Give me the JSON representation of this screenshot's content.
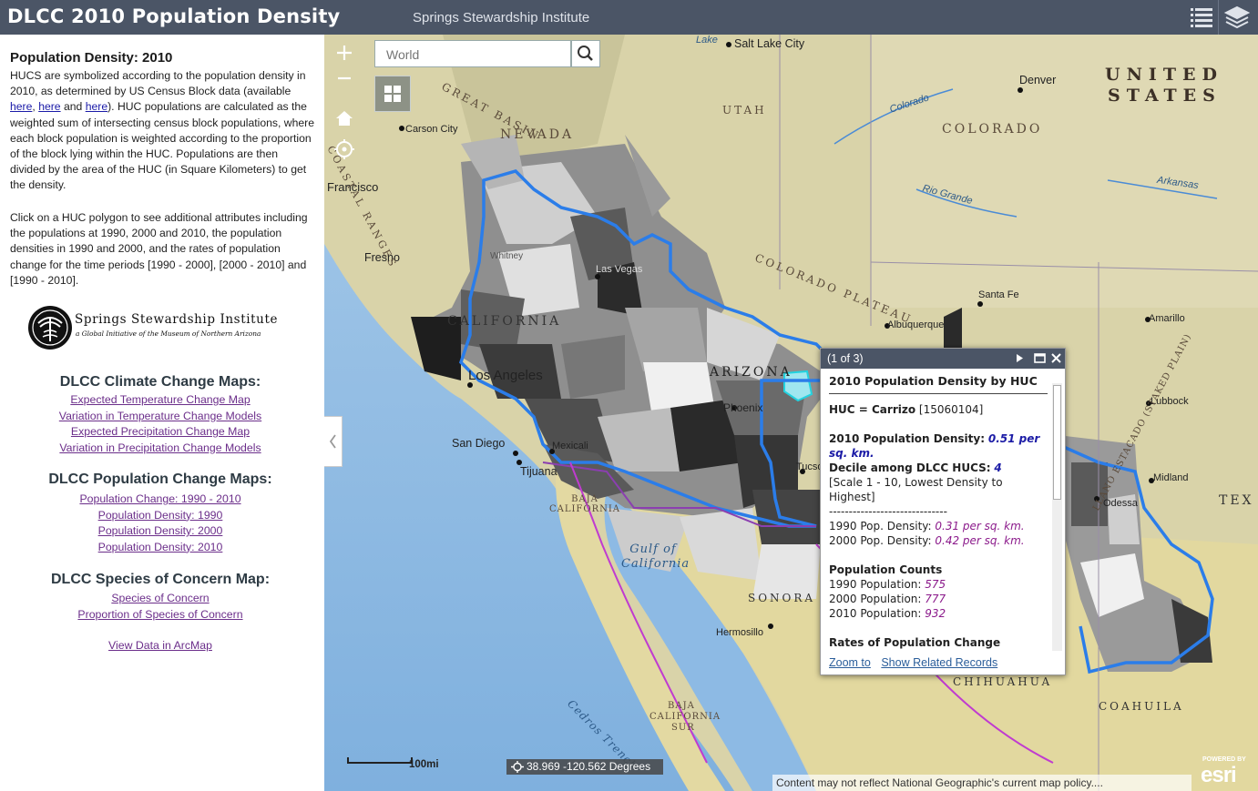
{
  "header": {
    "title": "DLCC 2010 Population Density",
    "subtitle": "Springs Stewardship Institute"
  },
  "sidebar": {
    "title": "Population Density: 2010",
    "intro_before": "HUCS are symbolized according to the population density in 2010, as determined by US Census Block data (available ",
    "link_here1": "here",
    "sep1": ", ",
    "link_here2": "here",
    "sep2": " and ",
    "link_here3": "here",
    "intro_after": ").  HUC populations are calculated as the weighted sum of intersecting census block populations, where each block population is weighted according to the proportion of the block lying within the HUC.  Populations are then divided by the area of the HUC (in Square Kilometers) to get the density.",
    "click_text": "Click on a HUC polygon to see additional attributes including the populations at 1990, 2000 and 2010, the population densities in 1990 and 2000, and the rates of population change for the time periods [1990 - 2000], [2000 - 2010] and [1990 - 2010].",
    "logo": {
      "name": "Springs Stewardship Institute",
      "tagline": "a Global Initiative of the Museum of Northern Arizona"
    },
    "climate": {
      "heading": "DLCC Climate Change Maps:",
      "links": [
        "Expected Temperature Change Map",
        "Variation in Temperature Change Models",
        "Expected Precipitation Change Map",
        "Variation in Precipitation Change Models"
      ]
    },
    "population": {
      "heading": "DLCC Population Change Maps:",
      "links": [
        "Population Change: 1990 - 2010",
        "Population Density: 1990",
        "Population Density: 2000",
        "Population Density: 2010"
      ]
    },
    "species": {
      "heading": "DLCC Species of Concern Map:",
      "links": [
        "Species of Concern",
        "Proportion of Species of Concern"
      ]
    },
    "arcmap_link": "View Data in ArcMap"
  },
  "map": {
    "search_placeholder": "World",
    "zoom_in": "+",
    "zoom_out": "−",
    "coords": "38.969 -120.562 Degrees",
    "scale_label": "100mi",
    "attribution": "Content may not reflect National Geographic's current map policy....",
    "esri_powered": "POWERED BY",
    "esri_logo": "esri",
    "labels": {
      "lake": "Lake",
      "salt_lake_city": "Salt Lake City",
      "denver": "Denver",
      "united": "UNITED",
      "states": "STATES",
      "nevada": "NEVADA",
      "utah": "UTAH",
      "colorado": "COLORADO",
      "carson_city": "Carson City",
      "great_basin": "GREAT  BASIN",
      "colorado_river": "Colorado",
      "rio_grande": "Rio Grande",
      "arkansas": "Arkansas",
      "san_francisco": "Francisco",
      "fresno": "Fresno",
      "whitney": "Whitney",
      "las_vegas": "Las Vegas",
      "colorado_plateau": "COLORADO  PLATEAU",
      "santa_fe": "Santa Fe",
      "albuquerque": "Albuquerque",
      "amarillo": "Amarillo",
      "california": "CALIFORNIA",
      "los_angeles": "Los Angeles",
      "arizona": "ARIZONA",
      "phoenix": "Phoenix",
      "lubbock": "Lubbock",
      "staked_plain": "LLANO ESTACADO (STAKED PLAIN)",
      "coastal_ranges": "COASTAL  RANGES",
      "san_diego": "San Diego",
      "mexicali": "Mexicali",
      "tijuana": "Tijuana",
      "tucson": "Tucson",
      "midland": "Midland",
      "odessa": "Odessa",
      "tex": "TEX",
      "baja_california": "BAJA CALIFORNIA",
      "gulf_of_california": "Gulf of California",
      "sonora": "SONORA",
      "hermosillo": "Hermosillo",
      "chihuahua": "CHIHUAHUA",
      "coahuila": "COAHUILA",
      "baja_california_sur_1": "BAJA",
      "baja_california_sur_2": "CALIFORNIA",
      "baja_california_sur_3": "SUR",
      "cedros_trench": "Cedros Trench"
    }
  },
  "popup": {
    "count": "(1 of 3)",
    "title": "2010 Population Density by HUC",
    "huc_label": "HUC = Carrizo",
    "huc_code": "[15060104]",
    "density_label": "2010 Population Density:",
    "density_value": "0.51 per sq. km.",
    "decile_label": "Decile among DLCC HUCS:",
    "decile_value": "4",
    "scale_note": "[Scale 1 - 10, Lowest Density to Highest]",
    "divider": "------------------------------",
    "d1990_label": "1990 Pop. Density:",
    "d1990_value": "0.31 per sq. km.",
    "d2000_label": "2000 Pop. Density:",
    "d2000_value": "0.42 per sq. km.",
    "counts_heading": "Population Counts",
    "p1990_label": "1990 Population:",
    "p1990_value": "575",
    "p2000_label": "2000 Population:",
    "p2000_value": "777",
    "p2010_label": "2010 Population:",
    "p2010_value": "932",
    "rates_heading": "Rates of Population Change",
    "zoom_to": "Zoom to",
    "show_related": "Show Related Records"
  },
  "colors": {
    "header_bg": "#4b5566",
    "boundary": "#2b7de9",
    "popup_value": "#1c1ca6",
    "popup_italic": "#8b1a8b",
    "link_visited": "#6b2e8a"
  }
}
